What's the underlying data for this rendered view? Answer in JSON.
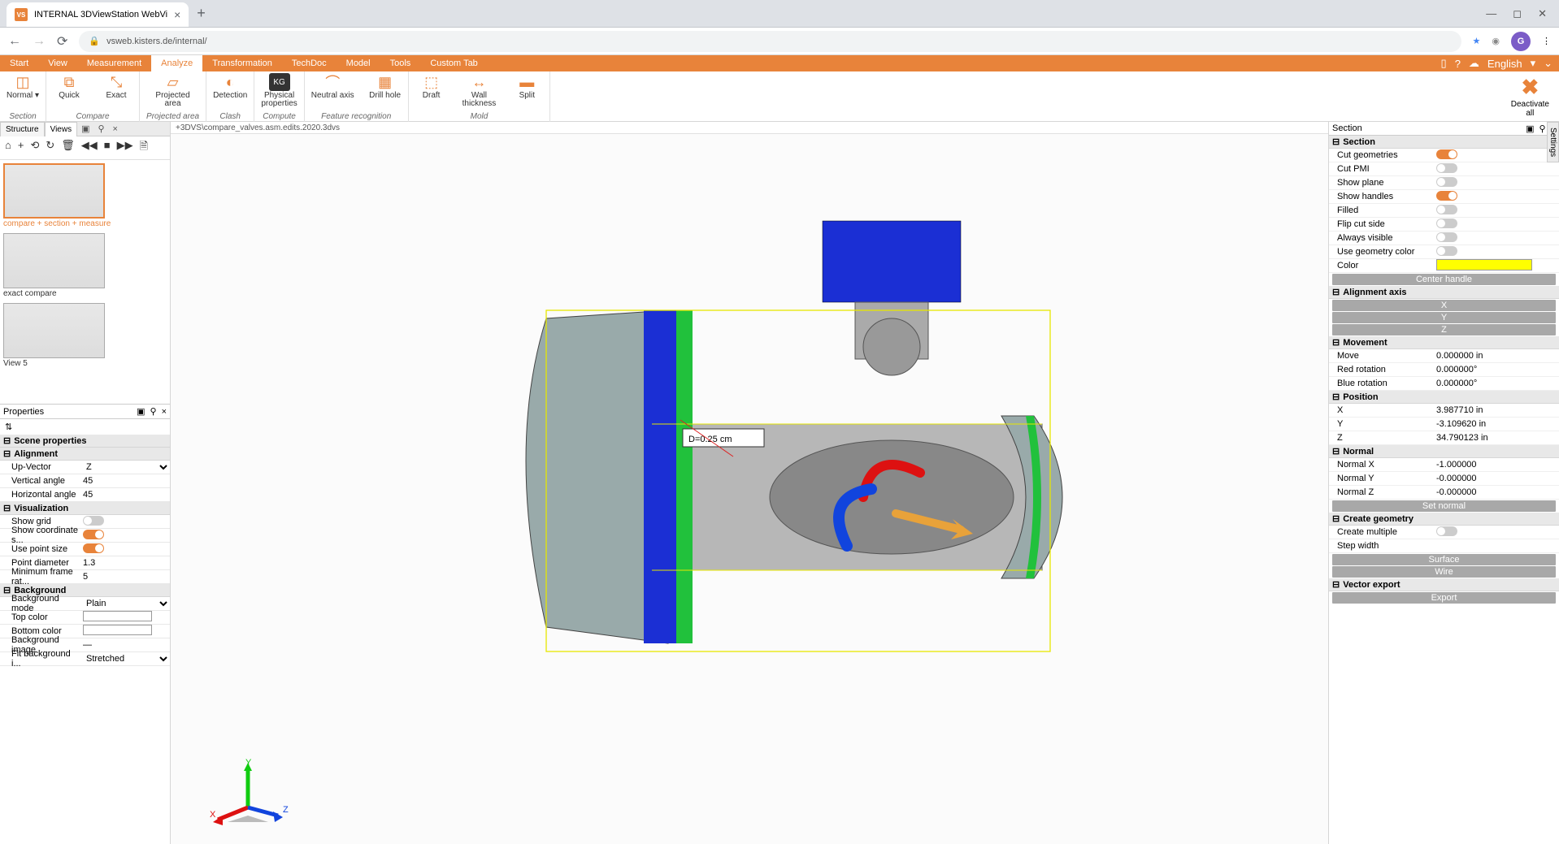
{
  "browser": {
    "tab_title": "INTERNAL 3DViewStation WebVi",
    "url": "vsweb.kisters.de/internal/",
    "avatar_letter": "G"
  },
  "menu": {
    "tabs": [
      "Start",
      "View",
      "Measurement",
      "Analyze",
      "Transformation",
      "TechDoc",
      "Model",
      "Tools",
      "Custom Tab"
    ],
    "active_index": 3,
    "language": "English"
  },
  "ribbon": {
    "groups": [
      {
        "label": "Section",
        "items": [
          {
            "name": "Normal ▾",
            "icon": "◫"
          }
        ]
      },
      {
        "label": "Compare",
        "items": [
          {
            "name": "Quick",
            "icon": "⧉"
          },
          {
            "name": "Exact",
            "icon": "⤡"
          }
        ]
      },
      {
        "label": "Projected area",
        "items": [
          {
            "name": "Projected\narea",
            "icon": "▱"
          }
        ]
      },
      {
        "label": "Clash",
        "items": [
          {
            "name": "Detection",
            "icon": "◐"
          }
        ]
      },
      {
        "label": "Compute",
        "items": [
          {
            "name": "Physical\nproperties",
            "icon": "KG"
          }
        ]
      },
      {
        "label": "Feature recognition",
        "items": [
          {
            "name": "Neutral axis",
            "icon": "⌒"
          },
          {
            "name": "Drill hole",
            "icon": "▦"
          }
        ]
      },
      {
        "label": "Mold",
        "items": [
          {
            "name": "Draft",
            "icon": "⬚"
          },
          {
            "name": "Wall\nthickness",
            "icon": "↔"
          },
          {
            "name": "Split",
            "icon": "▬"
          }
        ]
      }
    ],
    "deactivate": "Deactivate\nall"
  },
  "left": {
    "tabs": [
      "Structure",
      "Views"
    ],
    "active_tab": 1,
    "views": [
      {
        "label": "compare + section + measure",
        "active": true
      },
      {
        "label": "exact compare",
        "active": false
      },
      {
        "label": "View 5",
        "active": false
      }
    ],
    "props_title": "Properties",
    "scene_properties": "Scene properties",
    "alignment": {
      "title": "Alignment",
      "up_vector_label": "Up-Vector",
      "up_vector": "Z",
      "vertical_label": "Vertical angle",
      "vertical": "45",
      "horizontal_label": "Horizontal angle",
      "horizontal": "45"
    },
    "visualization": {
      "title": "Visualization",
      "show_grid": "Show grid",
      "show_grid_on": false,
      "show_coord": "Show coordinate s...",
      "show_coord_on": true,
      "use_point": "Use point size",
      "use_point_on": true,
      "point_diameter_label": "Point diameter",
      "point_diameter": "1.3",
      "min_frame_label": "Minimum frame rat...",
      "min_frame": "5"
    },
    "background": {
      "title": "Background",
      "mode_label": "Background mode",
      "mode": "Plain",
      "top_label": "Top color",
      "top_color": "#ffffff",
      "bottom_label": "Bottom color",
      "bottom_color": "#ffffff",
      "bg_image_label": "Background image",
      "bg_image": "—",
      "fit_label": "Fit background i...",
      "fit": "Stretched"
    }
  },
  "viewport": {
    "path": "+3DVS\\compare_valves.asm.edits.2020.3dvs",
    "measure_label": "D=0.25 cm",
    "axes": {
      "x": "X",
      "y": "Y",
      "z": "Z"
    }
  },
  "right": {
    "title": "Section",
    "section": {
      "title": "Section",
      "cut_geom": "Cut geometries",
      "cut_geom_on": true,
      "cut_pmi": "Cut PMI",
      "cut_pmi_on": false,
      "show_plane": "Show plane",
      "show_plane_on": false,
      "show_handles": "Show handles",
      "show_handles_on": true,
      "filled": "Filled",
      "filled_on": false,
      "flip": "Flip cut side",
      "flip_on": false,
      "always": "Always visible",
      "always_on": false,
      "use_geom_color": "Use geometry color",
      "use_geom_color_on": false,
      "color_label": "Color",
      "color": "#ffff00",
      "center_btn": "Center handle"
    },
    "alignment_axis": {
      "title": "Alignment axis",
      "x": "X",
      "y": "Y",
      "z": "Z"
    },
    "movement": {
      "title": "Movement",
      "move_label": "Move",
      "move": "0.000000 in",
      "red_label": "Red rotation",
      "red": "0.000000°",
      "blue_label": "Blue rotation",
      "blue": "0.000000°"
    },
    "position": {
      "title": "Position",
      "x_label": "X",
      "x": "3.987710 in",
      "y_label": "Y",
      "y": "-3.109620 in",
      "z_label": "Z",
      "z": "34.790123 in"
    },
    "normal": {
      "title": "Normal",
      "nx_label": "Normal X",
      "nx": "-1.000000",
      "ny_label": "Normal Y",
      "ny": "-0.000000",
      "nz_label": "Normal Z",
      "nz": "-0.000000",
      "set_btn": "Set normal"
    },
    "create": {
      "title": "Create geometry",
      "multiple": "Create multiple",
      "multiple_on": false,
      "step_label": "Step width",
      "surface_btn": "Surface",
      "wire_btn": "Wire"
    },
    "vector": {
      "title": "Vector export",
      "export_btn": "Export"
    }
  },
  "settings_tab": "Settings"
}
